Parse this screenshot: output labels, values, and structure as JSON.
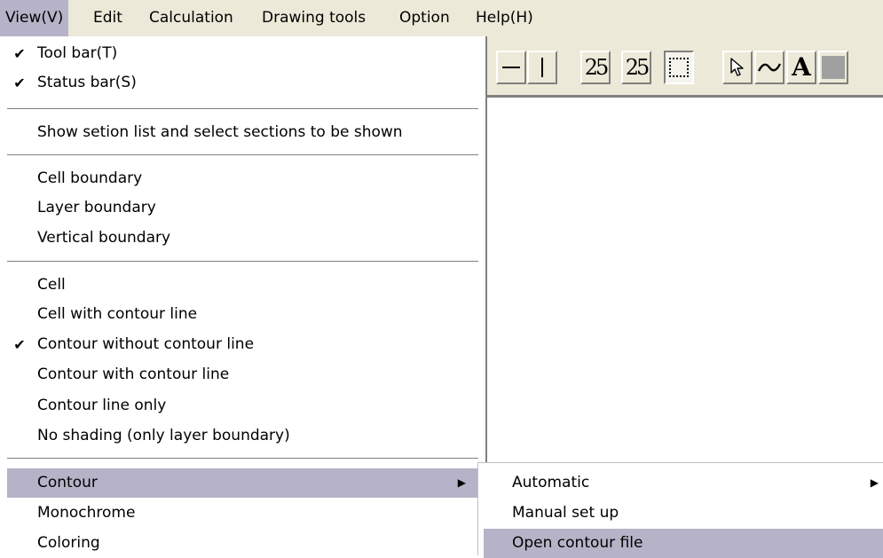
{
  "menubar": {
    "items": [
      {
        "label": "View(V)"
      },
      {
        "label": "Edit"
      },
      {
        "label": "Calculation"
      },
      {
        "label": "Drawing tools"
      },
      {
        "label": "Option"
      },
      {
        "label": "Help(H)"
      }
    ]
  },
  "toolbar": {
    "num_button_1": "25",
    "num_button_2": "25",
    "text_tool": "A"
  },
  "view_menu": {
    "toolbar": "Tool bar(T)",
    "statusbar": "Status bar(S)",
    "show_sections": "Show setion list and select sections to be shown",
    "cell_boundary": "Cell boundary",
    "layer_boundary": "Layer boundary",
    "vertical_boundary": "Vertical boundary",
    "cell": "Cell",
    "cell_contour_line": "Cell with contour line",
    "contour_without_line": "Contour without contour line",
    "contour_with_line": "Contour with contour line",
    "contour_line_only": "Contour line only",
    "no_shading": "No shading (only layer boundary)",
    "contour": "Contour",
    "monochrome": "Monochrome",
    "coloring": "Coloring",
    "checkmark": "✔",
    "submenu_arrow": "▶"
  },
  "contour_submenu": {
    "automatic": "Automatic",
    "manual": "Manual set up",
    "open_file": "Open contour file"
  },
  "colors": {
    "menubar_bg": "#ece9d8",
    "highlight": "#b6b3c8"
  }
}
